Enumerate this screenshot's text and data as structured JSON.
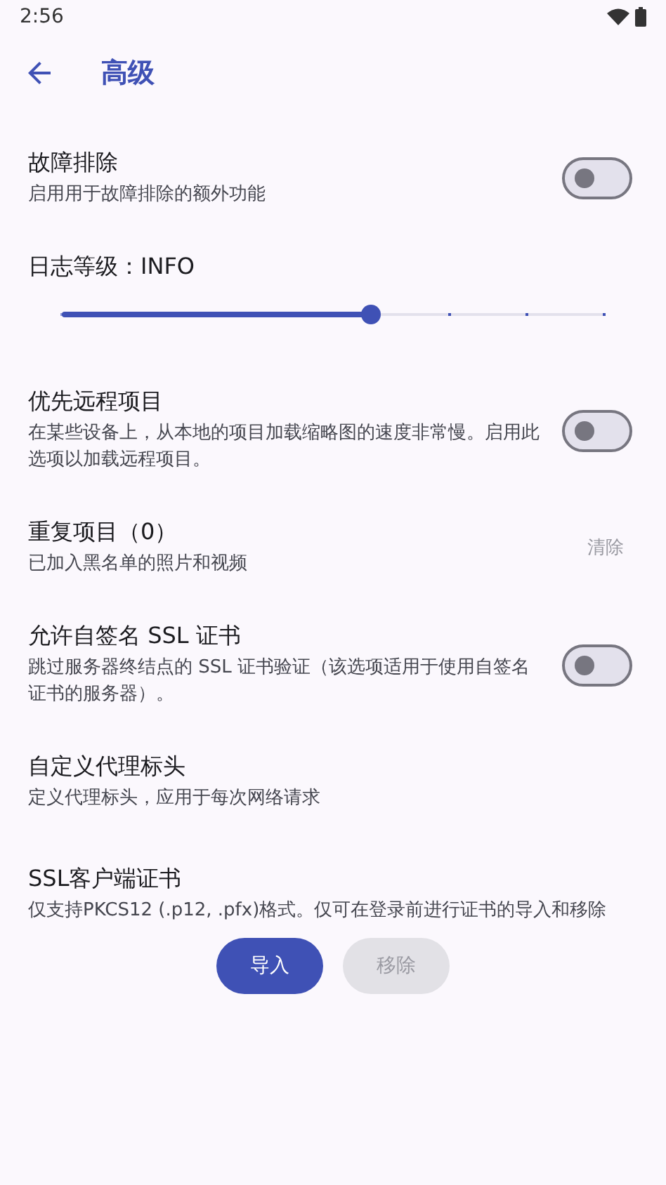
{
  "status_bar": {
    "time": "2:56"
  },
  "app_bar": {
    "title": "高级"
  },
  "settings": [
    {
      "kind": "toggle",
      "title": "故障排除",
      "subtitle": "启用用于故障排除的额外功能",
      "on": false
    },
    {
      "kind": "slider",
      "title": "日志等级：INFO",
      "level": 0.571
    },
    {
      "kind": "toggle",
      "title": "优先远程项目",
      "subtitle": "在某些设备上，从本地的项目加载缩略图的速度非常慢。启用此选项以加载远程项目。",
      "on": false
    },
    {
      "kind": "action",
      "title": "重复项目（0）",
      "subtitle": "已加入黑名单的照片和视频",
      "action": "清除",
      "disabled": true
    },
    {
      "kind": "toggle",
      "title": "允许自签名 SSL 证书",
      "subtitle": "跳过服务器终结点的 SSL 证书验证（该选项适用于使用自签名证书的服务器）。",
      "on": false
    },
    {
      "kind": "plain",
      "title": "自定义代理标头",
      "subtitle": "定义代理标头，应用于每次网络请求"
    },
    {
      "kind": "buttons",
      "title": "SSL客户端证书",
      "subtitle": "仅支持PKCS12 (.p12, .pfx)格式。仅可在登录前进行证书的导入和移除",
      "buttons": [
        {
          "label": "导入",
          "disabled": false
        },
        {
          "label": "移除",
          "disabled": true
        }
      ]
    }
  ]
}
